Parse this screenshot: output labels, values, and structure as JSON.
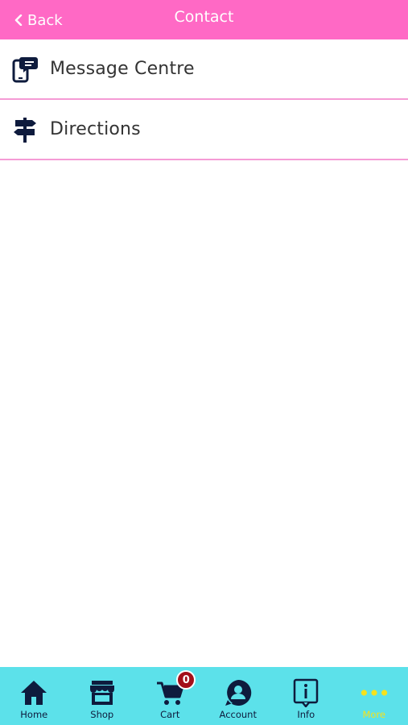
{
  "header": {
    "back_label": "Back",
    "title": "Contact",
    "background": "#ff69c5"
  },
  "list": {
    "items": [
      {
        "label": "Message Centre",
        "icon": "message-phone-icon"
      },
      {
        "label": "Directions",
        "icon": "signpost-icon"
      }
    ],
    "divider_color": "#f59bd5"
  },
  "tabbar": {
    "background": "#5ce1ea",
    "items": [
      {
        "label": "Home",
        "icon": "home-icon"
      },
      {
        "label": "Shop",
        "icon": "shop-icon"
      },
      {
        "label": "Cart",
        "icon": "cart-icon",
        "badge": "0"
      },
      {
        "label": "Account",
        "icon": "account-icon"
      },
      {
        "label": "Info",
        "icon": "info-icon"
      },
      {
        "label": "More",
        "icon": "more-icon",
        "active": true,
        "active_color": "#f6e21c"
      }
    ]
  }
}
